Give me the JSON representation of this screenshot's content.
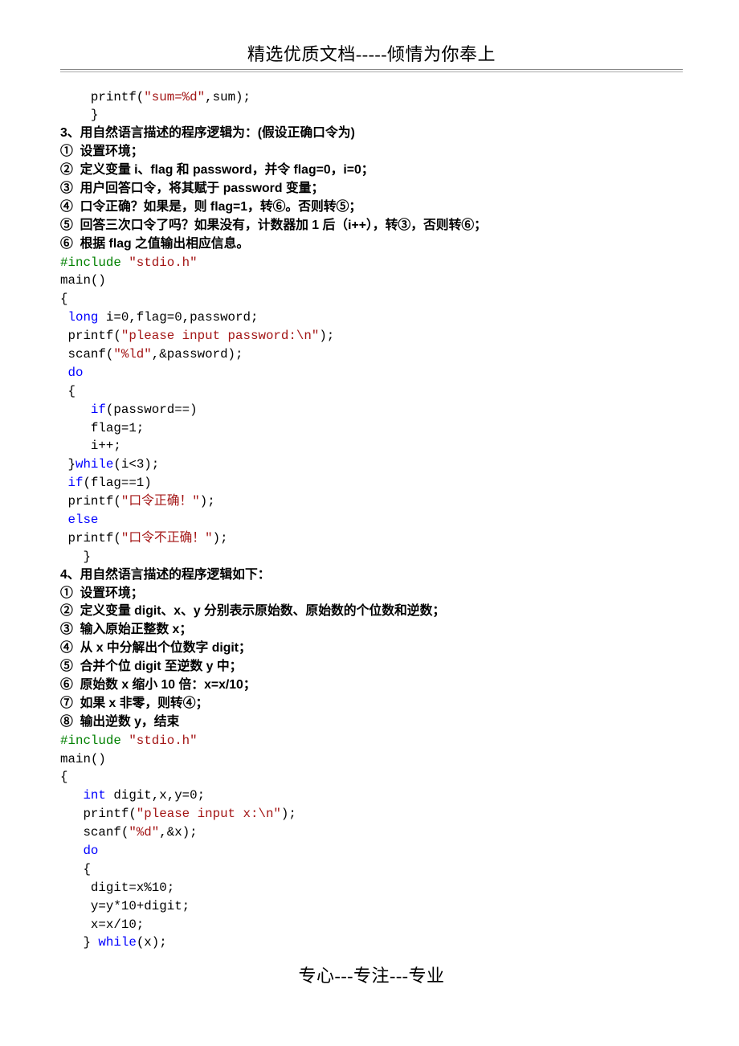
{
  "header": {
    "title": "精选优质文档-----倾情为你奉上"
  },
  "footer": {
    "title": "专心---专注---专业"
  },
  "block_a": {
    "line1_pre": "    printf(",
    "line1_str": "\"sum=%d\"",
    "line1_post": ",sum);",
    "line2": "    }"
  },
  "q3": {
    "h": "3、用自然语言描述的程序逻辑为：(假设正确口令为)",
    "l1": "①  设置环境；",
    "l2": "②  定义变量 i、flag 和 password，并令 flag=0，i=0；",
    "l3": "③  用户回答口令，将其赋于 password 变量；",
    "l4": "④  口令正确？如果是，则 flag=1，转⑥。否则转⑤；",
    "l5": "⑤  回答三次口令了吗？如果没有，计数器加 1 后（i++），转③，否则转⑥；",
    "l6": "⑥  根据 flag 之值输出相应信息。"
  },
  "code3": {
    "c01a": "#include ",
    "c01b": "\"stdio.h\"",
    "c02": "main()",
    "c03": "{",
    "c04a": " long",
    "c04b": " i=0,flag=0,password;",
    "c05a": " printf(",
    "c05b": "\"please input password:\\n\"",
    "c05c": ");",
    "c06a": " scanf(",
    "c06b": "\"%ld\"",
    "c06c": ",&password);",
    "c07": " do",
    "c08": " {",
    "c09a": "    if",
    "c09b": "(password==)",
    "c10": "    flag=1;",
    "c11": "    i++;",
    "c12a": " }",
    "c12b": "while",
    "c12c": "(i<3);",
    "c13a": " if",
    "c13b": "(flag==1)",
    "c14a": " printf(",
    "c14b": "\"口令正确！\"",
    "c14c": ");",
    "c15": " else",
    "c16a": " printf(",
    "c16b": "\"口令不正确！\"",
    "c16c": ");",
    "c17": "   }"
  },
  "q4": {
    "h": "4、用自然语言描述的程序逻辑如下：",
    "l1": "①  设置环境；",
    "l2": "②  定义变量 digit、x、y 分别表示原始数、原始数的个位数和逆数；",
    "l3": "③  输入原始正整数 x；",
    "l4": "④  从 x 中分解出个位数字 digit；",
    "l5": "⑤  合并个位 digit 至逆数 y 中；",
    "l6": "⑥  原始数 x 缩小 10 倍：x=x/10；",
    "l7": "⑦  如果 x 非零，则转④；",
    "l8": "⑧  输出逆数 y，结束"
  },
  "code4": {
    "c01a": "#include ",
    "c01b": "\"stdio.h\"",
    "c02": "main()",
    "c03": "{",
    "c04a": "   int",
    "c04b": " digit,x,y=0;",
    "c05a": "   printf(",
    "c05b": "\"please input x:\\n\"",
    "c05c": ");",
    "c06a": "   scanf(",
    "c06b": "\"%d\"",
    "c06c": ",&x);",
    "c07": "   do",
    "c08": "   {",
    "c09": "    digit=x%10;",
    "c10": "    y=y*10+digit;",
    "c11": "    x=x/10;",
    "c12a": "   } ",
    "c12b": "while",
    "c12c": "(x);"
  }
}
